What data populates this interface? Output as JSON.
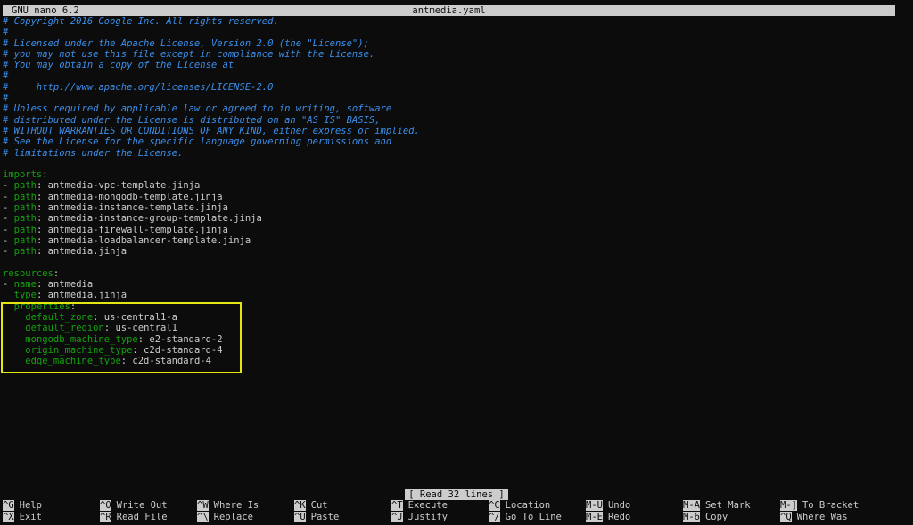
{
  "titlebar": {
    "app": "GNU nano 6.2",
    "file": "antmedia.yaml"
  },
  "status": "[ Read 32 lines ]",
  "colors": {
    "background": "#0c0c0c",
    "comment": "#3b8eea",
    "key": "#13a10e",
    "text": "#cccccc",
    "highlight": "#e5e510"
  },
  "lines": [
    {
      "type": "comment",
      "text": "# Copyright 2016 Google Inc. All rights reserved."
    },
    {
      "type": "comment",
      "text": "#"
    },
    {
      "type": "comment",
      "text": "# Licensed under the Apache License, Version 2.0 (the \"License\");"
    },
    {
      "type": "comment",
      "text": "# you may not use this file except in compliance with the License."
    },
    {
      "type": "comment",
      "text": "# You may obtain a copy of the License at"
    },
    {
      "type": "comment",
      "text": "#"
    },
    {
      "type": "comment",
      "text": "#     http://www.apache.org/licenses/LICENSE-2.0"
    },
    {
      "type": "comment",
      "text": "#"
    },
    {
      "type": "comment",
      "text": "# Unless required by applicable law or agreed to in writing, software"
    },
    {
      "type": "comment",
      "text": "# distributed under the License is distributed on an \"AS IS\" BASIS,"
    },
    {
      "type": "comment",
      "text": "# WITHOUT WARRANTIES OR CONDITIONS OF ANY KIND, either express or implied."
    },
    {
      "type": "comment",
      "text": "# See the License for the specific language governing permissions and"
    },
    {
      "type": "comment",
      "text": "# limitations under the License."
    },
    {
      "type": "blank",
      "text": ""
    },
    {
      "type": "kv",
      "prefix": "",
      "key": "imports",
      "value": ""
    },
    {
      "type": "kv",
      "prefix": "- ",
      "key": "path",
      "value": " antmedia-vpc-template.jinja"
    },
    {
      "type": "kv",
      "prefix": "- ",
      "key": "path",
      "value": " antmedia-mongodb-template.jinja"
    },
    {
      "type": "kv",
      "prefix": "- ",
      "key": "path",
      "value": " antmedia-instance-template.jinja"
    },
    {
      "type": "kv",
      "prefix": "- ",
      "key": "path",
      "value": " antmedia-instance-group-template.jinja"
    },
    {
      "type": "kv",
      "prefix": "- ",
      "key": "path",
      "value": " antmedia-firewall-template.jinja"
    },
    {
      "type": "kv",
      "prefix": "- ",
      "key": "path",
      "value": " antmedia-loadbalancer-template.jinja"
    },
    {
      "type": "kv",
      "prefix": "- ",
      "key": "path",
      "value": " antmedia.jinja"
    },
    {
      "type": "blank",
      "text": ""
    },
    {
      "type": "kv",
      "prefix": "",
      "key": "resources",
      "value": ""
    },
    {
      "type": "kv",
      "prefix": "- ",
      "key": "name",
      "value": " antmedia"
    },
    {
      "type": "kv",
      "prefix": "  ",
      "key": "type",
      "value": " antmedia.jinja"
    },
    {
      "type": "kv",
      "prefix": "  ",
      "key": "properties",
      "value": ""
    },
    {
      "type": "kv",
      "prefix": "    ",
      "key": "default_zone",
      "value": " us-central1-a"
    },
    {
      "type": "kv",
      "prefix": "    ",
      "key": "default_region",
      "value": " us-central1"
    },
    {
      "type": "kv",
      "prefix": "    ",
      "key": "mongodb_machine_type",
      "value": " e2-standard-2"
    },
    {
      "type": "kv",
      "prefix": "    ",
      "key": "origin_machine_type",
      "value": " c2d-standard-4"
    },
    {
      "type": "kv",
      "prefix": "    ",
      "key": "edge_machine_type",
      "value": " c2d-standard-4"
    }
  ],
  "shortcuts": [
    {
      "key": "^G",
      "label": "Help"
    },
    {
      "key": "^X",
      "label": "Exit"
    },
    {
      "key": "^O",
      "label": "Write Out"
    },
    {
      "key": "^R",
      "label": "Read File"
    },
    {
      "key": "^W",
      "label": "Where Is"
    },
    {
      "key": "^\\",
      "label": "Replace"
    },
    {
      "key": "^K",
      "label": "Cut"
    },
    {
      "key": "^U",
      "label": "Paste"
    },
    {
      "key": "^T",
      "label": "Execute"
    },
    {
      "key": "^J",
      "label": "Justify"
    },
    {
      "key": "^C",
      "label": "Location"
    },
    {
      "key": "^/",
      "label": "Go To Line"
    },
    {
      "key": "M-U",
      "label": "Undo"
    },
    {
      "key": "M-E",
      "label": "Redo"
    },
    {
      "key": "M-A",
      "label": "Set Mark"
    },
    {
      "key": "M-6",
      "label": "Copy"
    },
    {
      "key": "M-]",
      "label": "To Bracket"
    },
    {
      "key": "^Q",
      "label": "Where Was"
    }
  ]
}
